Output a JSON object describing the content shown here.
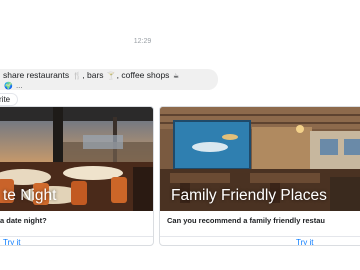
{
  "chat": {
    "timestamp": "12:29",
    "message_line1_parts": [
      "share restaurants",
      "bars",
      "coffee shops"
    ],
    "message_line1_seps": [
      ",",
      ","
    ],
    "message_line2": "...",
    "chip_label": "rite"
  },
  "cards": [
    {
      "overlay_title": "te Night",
      "question": "a date night?",
      "action": "Try it"
    },
    {
      "overlay_title": "Family Friendly Places",
      "question": "Can you recommend a family friendly restau",
      "action": "Try it"
    }
  ],
  "colors": {
    "link": "#0a7cff",
    "bubble": "#f0f0f0",
    "text": "#1c1e21"
  }
}
